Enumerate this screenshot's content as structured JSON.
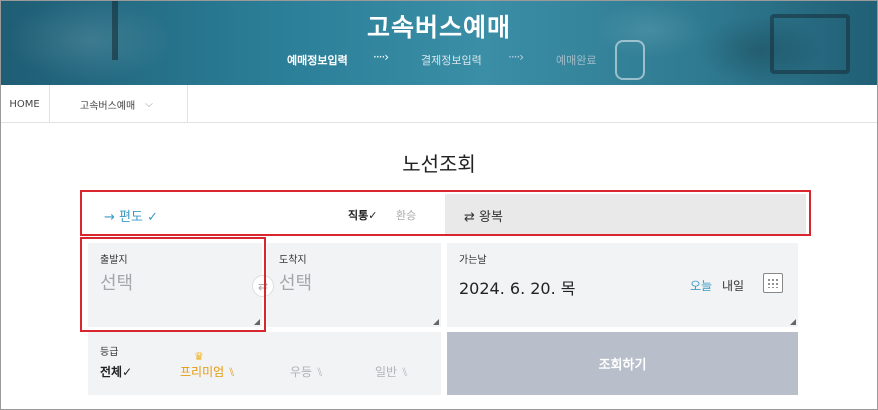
{
  "hero": {
    "title": "고속버스예매",
    "steps": [
      "예매정보입력",
      "결제정보입력",
      "예매완료"
    ],
    "arrow": "····›"
  },
  "breadcrumb": {
    "home": "HOME",
    "item": "고속버스예매",
    "chevron": "⌵"
  },
  "page_title": "노선조회",
  "trip": {
    "oneway": "→ 편도 ✓",
    "direct": "직통✓",
    "transfer": "환승",
    "roundtrip": "⇄ 왕복"
  },
  "departure": {
    "label": "출발지",
    "placeholder": "선택"
  },
  "arrival": {
    "label": "도착지",
    "placeholder": "선택"
  },
  "swap_icon": "⇄",
  "date": {
    "label": "가는날",
    "value": "2024. 6. 20. 목",
    "today": "오늘",
    "tomorrow": "내일"
  },
  "grade": {
    "label": "등급",
    "options": [
      "전체✓",
      "프리미엄",
      "우등",
      "일반"
    ],
    "crown": "♛",
    "seat_glyph": "⑊"
  },
  "search_button": "조회하기",
  "colors": {
    "accent": "#3b9bc5",
    "highlight": "#d9252e",
    "premium": "#e59a0f",
    "button": "#b9becb"
  }
}
